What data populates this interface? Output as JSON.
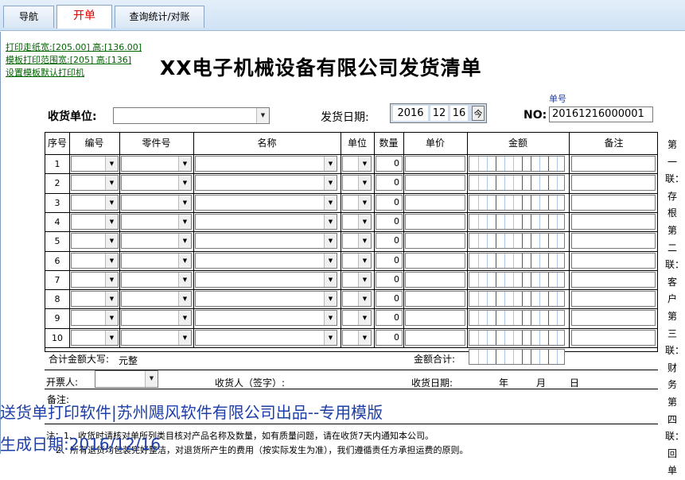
{
  "tabs": [
    {
      "label": "导航"
    },
    {
      "label": "开单"
    },
    {
      "label": "查询统计/对账"
    }
  ],
  "print_links": {
    "paper": "打印走纸宽:[205.00] 高:[136.00]",
    "range": "模板打印范围宽:[205] 高:[136]",
    "default_printer": "设置模板默认打印机"
  },
  "title": "XX电子机械设备有限公司发货清单",
  "form": {
    "receiver_label": "收货单位:",
    "receiver_value": "",
    "date_label": "发货日期:",
    "date_year": "2016",
    "date_month": "12",
    "date_day": "16",
    "calendar_glyph": "今",
    "order_no_caption": "单号",
    "no_label": "NO:",
    "no_value": "20161216000001"
  },
  "table": {
    "headers": [
      "序号",
      "编号",
      "零件号",
      "名称",
      "单位",
      "数量",
      "单价",
      "金额",
      "备注"
    ],
    "rows": [
      {
        "n": "1",
        "qty": "0"
      },
      {
        "n": "2",
        "qty": "0"
      },
      {
        "n": "3",
        "qty": "0"
      },
      {
        "n": "4",
        "qty": "0"
      },
      {
        "n": "5",
        "qty": "0"
      },
      {
        "n": "6",
        "qty": "0"
      },
      {
        "n": "7",
        "qty": "0"
      },
      {
        "n": "8",
        "qty": "0"
      },
      {
        "n": "9",
        "qty": "0"
      },
      {
        "n": "10",
        "qty": "0"
      }
    ],
    "total_upper_label": "合计金额大写:",
    "total_upper_value": "元整",
    "total_label": "金额合计:"
  },
  "footer": {
    "issuer_label": "开票人:",
    "signer_label": "收货人（签字）:",
    "recv_date_label": "收货日期:",
    "year": "年",
    "month": "月",
    "day": "日",
    "remark_label": "备注:",
    "note1": "注：1、收货时请核对单所列类目核对产品名称及数量，如有质量问题，请在收货7天内通知本公司。",
    "note2": "2、所有退货均包装完好整洁，对退货所产生的费用（按实际发生为准），我们遵循责任方承担运费的原则。"
  },
  "side_label": "第一联：存根 第二联：客户 第三联：财务 第四联：回单",
  "watermark": {
    "line1": "送货单打印软件|苏州飓风软件有限公司出品--专用模版",
    "line2": "生成日期:2016/12/16"
  },
  "colors": {
    "accent_red": "#e00000",
    "link_green": "#006400",
    "watermark_blue": "#1e3fa8",
    "amount_grid_red": "#dd2233"
  }
}
